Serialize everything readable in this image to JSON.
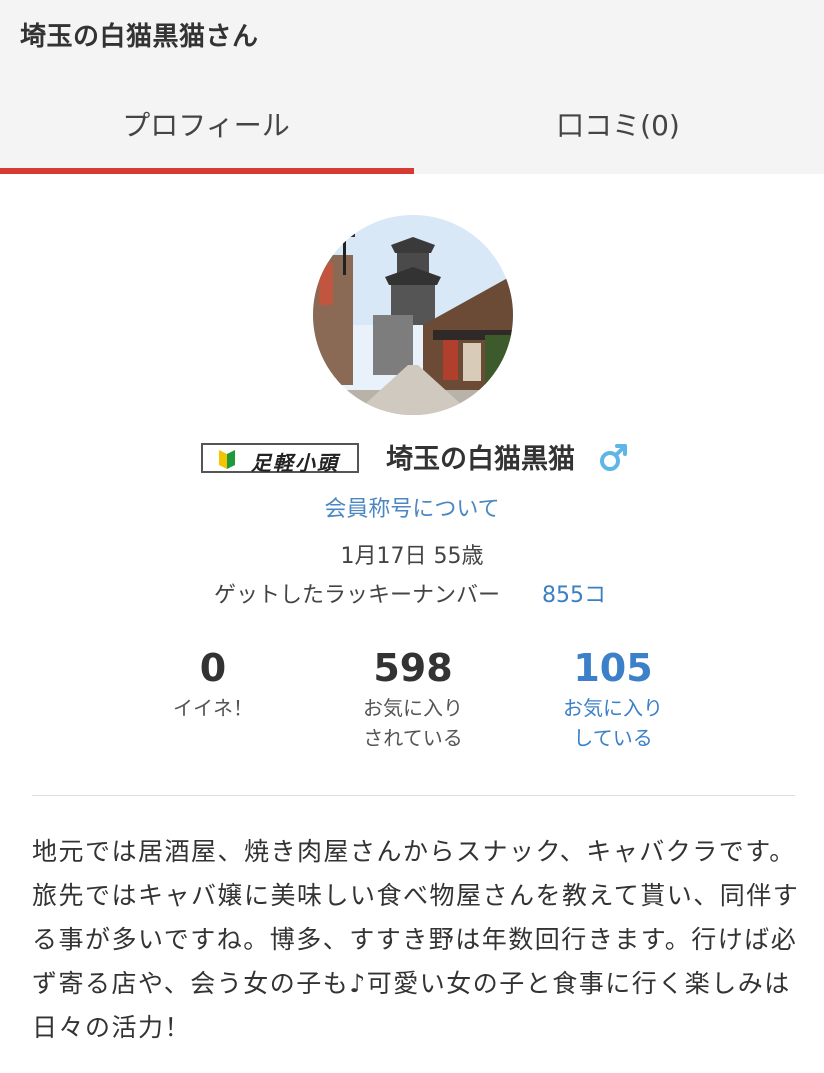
{
  "header": {
    "title": "埼玉の白猫黒猫さん"
  },
  "tabs": [
    {
      "label": "プロフィール",
      "active": true
    },
    {
      "label": "口コミ(0)",
      "active": false
    }
  ],
  "colors": {
    "accent": "#d63a33",
    "link": "#4b87c1",
    "highlight": "#3b80c8",
    "gender": "#5fb6e6"
  },
  "profile": {
    "rank_badge": "足軽小頭",
    "username": "埼玉の白猫黒猫",
    "gender_icon": "male-symbol-icon",
    "title_link": "会員称号について",
    "birthday_age": "1月17日 55歳",
    "lucky_label": "ゲットしたラッキーナンバー",
    "lucky_count": "855コ"
  },
  "stats": [
    {
      "value": "0",
      "label_line1": "イイネ！",
      "label_line2": ""
    },
    {
      "value": "598",
      "label_line1": "お気に入り",
      "label_line2": "されている"
    },
    {
      "value": "105",
      "label_line1": "お気に入り",
      "label_line2": "している"
    }
  ],
  "bio": "地元では居酒屋、焼き肉屋さんからスナック、キャバクラです。旅先ではキャバ嬢に美味しい食べ物屋さんを教えて貰い、同伴する事が多いですね。博多、すすき野は年数回行きます。行けば必ず寄る店や、会う女の子も♪可愛い女の子と食事に行く楽しみは日々の活力！"
}
